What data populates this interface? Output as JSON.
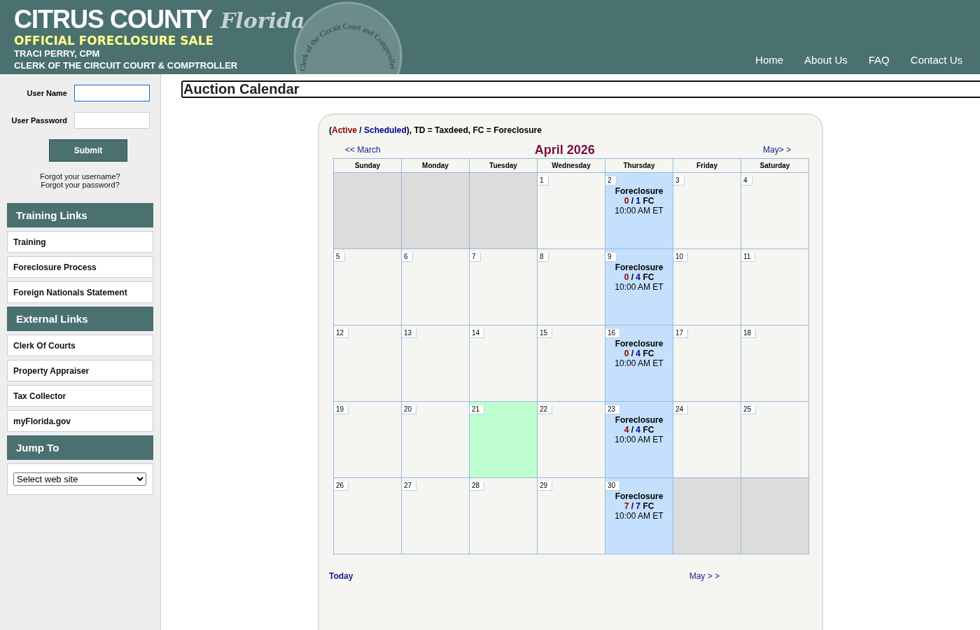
{
  "header": {
    "title": "CITRUS COUNTY",
    "script_title": "Florida",
    "subtitle": "OFFICIAL FORECLOSURE SALE",
    "name": "TRACI PERRY, CPM",
    "office": "CLERK OF THE CIRCUIT COURT & COMPTROLLER",
    "seal_text": "Clerk of the Circuit Court and Comptroller"
  },
  "nav": [
    "Home",
    "About Us",
    "FAQ",
    "Contact Us"
  ],
  "login": {
    "username_label": "User Name",
    "password_label": "User Password",
    "submit": "Submit",
    "forgot_username": "Forgot your username?",
    "forgot_password": "Forgot your password?"
  },
  "sidebar": [
    {
      "heading": "Training Links",
      "links": [
        "Training",
        "Foreclosure Process",
        "Foreign Nationals Statement"
      ]
    },
    {
      "heading": "External Links",
      "links": [
        "Clerk Of Courts",
        "Property Appraiser",
        "Tax Collector",
        "myFlorida.gov"
      ]
    },
    {
      "heading": "Jump To",
      "select": "Select web site"
    }
  ],
  "page_title": "Auction Calendar",
  "calendar": {
    "legend": [
      {
        "kind": "plain",
        "text": "("
      },
      {
        "kind": "active",
        "text": "Active"
      },
      {
        "kind": "plain",
        "text": " / "
      },
      {
        "kind": "scheduled",
        "text": "Scheduled"
      },
      {
        "kind": "plain",
        "text": "), TD = Taxdeed, FC = Foreclosure"
      }
    ],
    "prev": "<< March",
    "month": "April 2026",
    "next": "May> >",
    "weekdays": [
      "Sunday",
      "Monday",
      "Tuesday",
      "Wednesday",
      "Thursday",
      "Friday",
      "Saturday"
    ],
    "weeks": [
      [
        {
          "kind": "empty"
        },
        {
          "kind": "empty"
        },
        {
          "kind": "empty"
        },
        {
          "kind": "day",
          "day": "1",
          "today": false
        },
        {
          "kind": "auction",
          "day": "2",
          "today": false,
          "type": "Foreclosure",
          "active": "0",
          "separator": "/",
          "scheduled": "1",
          "code": "FC",
          "time": "10:00 AM ET"
        },
        {
          "kind": "day",
          "day": "3",
          "today": false
        },
        {
          "kind": "day",
          "day": "4",
          "today": false
        }
      ],
      [
        {
          "kind": "day",
          "day": "5",
          "today": false
        },
        {
          "kind": "day",
          "day": "6",
          "today": false
        },
        {
          "kind": "day",
          "day": "7",
          "today": false
        },
        {
          "kind": "day",
          "day": "8",
          "today": false
        },
        {
          "kind": "auction",
          "day": "9",
          "today": false,
          "type": "Foreclosure",
          "active": "0",
          "separator": "/",
          "scheduled": "4",
          "code": "FC",
          "time": "10:00 AM ET"
        },
        {
          "kind": "day",
          "day": "10",
          "today": false
        },
        {
          "kind": "day",
          "day": "11",
          "today": false
        }
      ],
      [
        {
          "kind": "day",
          "day": "12",
          "today": false
        },
        {
          "kind": "day",
          "day": "13",
          "today": false
        },
        {
          "kind": "day",
          "day": "14",
          "today": false
        },
        {
          "kind": "day",
          "day": "15",
          "today": false
        },
        {
          "kind": "auction",
          "day": "16",
          "today": false,
          "type": "Foreclosure",
          "active": "0",
          "separator": "/",
          "scheduled": "4",
          "code": "FC",
          "time": "10:00 AM ET"
        },
        {
          "kind": "day",
          "day": "17",
          "today": false
        },
        {
          "kind": "day",
          "day": "18",
          "today": false
        }
      ],
      [
        {
          "kind": "day",
          "day": "19",
          "today": false
        },
        {
          "kind": "day",
          "day": "20",
          "today": false
        },
        {
          "kind": "day",
          "day": "21",
          "today": true
        },
        {
          "kind": "day",
          "day": "22",
          "today": false
        },
        {
          "kind": "auction",
          "day": "23",
          "today": false,
          "type": "Foreclosure",
          "active": "4",
          "separator": "/",
          "scheduled": "4",
          "code": "FC",
          "time": "10:00 AM ET"
        },
        {
          "kind": "day",
          "day": "24",
          "today": false
        },
        {
          "kind": "day",
          "day": "25",
          "today": false
        }
      ],
      [
        {
          "kind": "day",
          "day": "26",
          "today": false
        },
        {
          "kind": "day",
          "day": "27",
          "today": false
        },
        {
          "kind": "day",
          "day": "28",
          "today": false
        },
        {
          "kind": "day",
          "day": "29",
          "today": false
        },
        {
          "kind": "auction",
          "day": "30",
          "today": false,
          "type": "Foreclosure",
          "active": "7",
          "separator": "/",
          "scheduled": "7",
          "code": "FC",
          "time": "10:00 AM ET"
        },
        {
          "kind": "empty"
        },
        {
          "kind": "empty"
        }
      ]
    ],
    "today_link": "Today",
    "next_bottom": "May > >"
  }
}
